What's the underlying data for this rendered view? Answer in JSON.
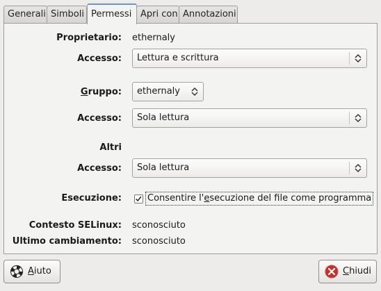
{
  "tabs": [
    {
      "label": "Generali"
    },
    {
      "label": "Simboli"
    },
    {
      "label": "Permessi",
      "active": true
    },
    {
      "label": "Apri con"
    },
    {
      "label": "Annotazioni"
    }
  ],
  "owner": {
    "label": "Proprietario:",
    "value": "ethernaly"
  },
  "owner_access": {
    "label": "Accesso:",
    "value": "Lettura e scrittura"
  },
  "group": {
    "label_mnemonic": "G",
    "label_rest": "ruppo:",
    "value": "ethernaly"
  },
  "group_access": {
    "label": "Accesso:",
    "value": "Sola lettura"
  },
  "others": {
    "heading": "Altri"
  },
  "others_access": {
    "label": "Accesso:",
    "value": "Sola lettura"
  },
  "execution": {
    "label": "Esecuzione:",
    "checked": true,
    "text_before": "Consentire l'",
    "text_mnemonic": "e",
    "text_after": "secuzione del file come programma"
  },
  "selinux": {
    "label": "Contesto SELinux:",
    "value": "sconosciuto"
  },
  "last_change": {
    "label": "Ultimo cambiamento:",
    "value": "sconosciuto"
  },
  "buttons": {
    "help": {
      "mnemonic": "A",
      "rest": "iuto",
      "icon": "lifebuoy-icon"
    },
    "close": {
      "mnemonic": "C",
      "rest": "hiudi",
      "icon": "close-icon"
    }
  },
  "colors": {
    "window_bg": "#edeceb",
    "panel_bg": "#f3f3f2",
    "tab_accent": "#6c95c6"
  }
}
